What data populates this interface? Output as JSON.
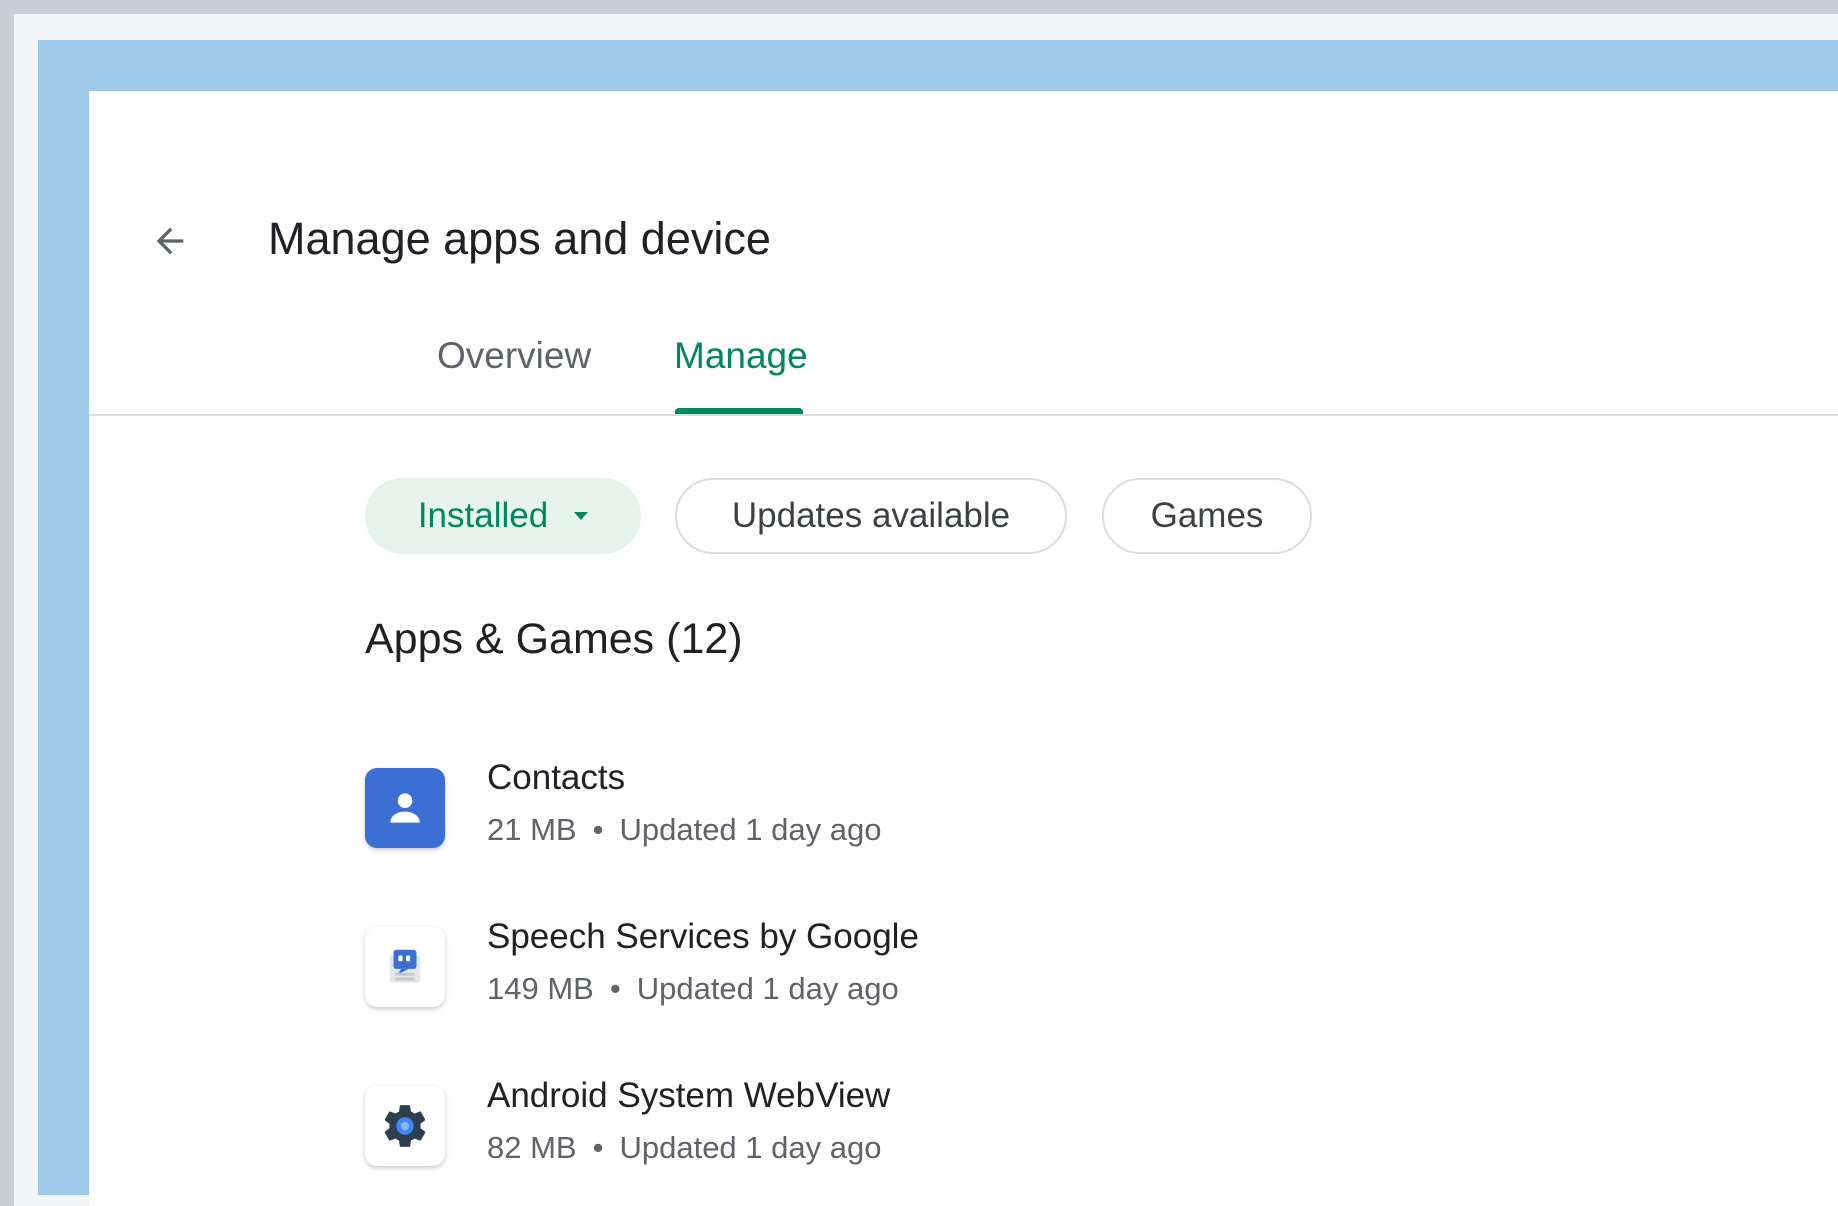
{
  "header": {
    "back_icon": "arrow-left-icon",
    "title": "Manage apps and device"
  },
  "tabs": [
    {
      "label": "Overview",
      "active": false
    },
    {
      "label": "Manage",
      "active": true
    }
  ],
  "filters": {
    "installed": {
      "label": "Installed",
      "icon": "caret-down-icon",
      "selected": true
    },
    "updates": {
      "label": "Updates available",
      "selected": false
    },
    "games": {
      "label": "Games",
      "selected": false
    }
  },
  "section": {
    "heading": "Apps & Games (12)"
  },
  "apps": [
    {
      "name": "Contacts",
      "size": "21 MB",
      "separator": "•",
      "updated": "Updated 1 day ago",
      "icon": "contacts-icon"
    },
    {
      "name": "Speech Services by Google",
      "size": "149 MB",
      "separator": "•",
      "updated": "Updated 1 day ago",
      "icon": "speech-services-icon"
    },
    {
      "name": "Android System WebView",
      "size": "82 MB",
      "separator": "•",
      "updated": "Updated 1 day ago",
      "icon": "webview-gear-icon"
    }
  ],
  "colors": {
    "accent": "#01875f",
    "chip_selected_bg": "#e6f3ed",
    "frame_blue": "#9fc9e8",
    "contacts_blue": "#3b6fd4"
  }
}
